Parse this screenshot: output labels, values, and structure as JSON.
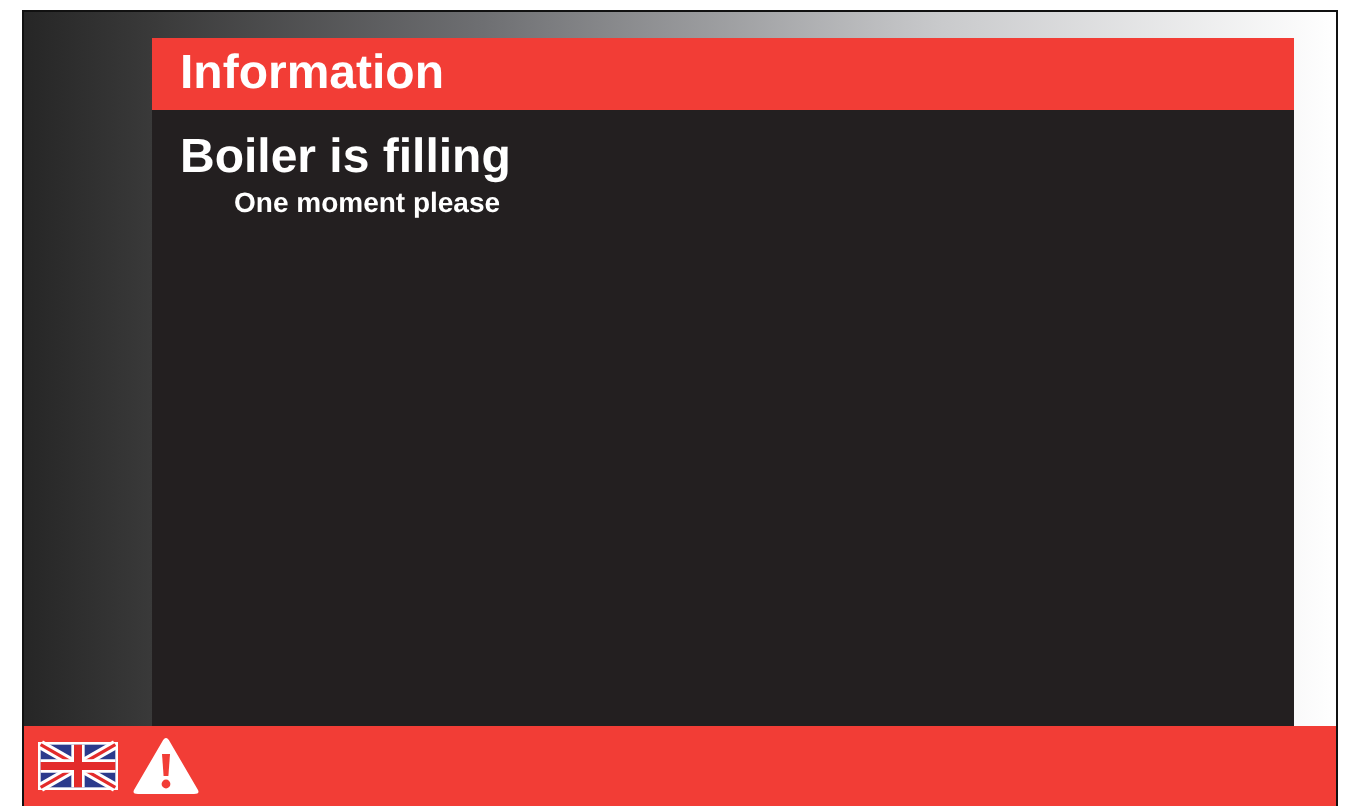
{
  "header": {
    "title": "Information"
  },
  "message": {
    "title": "Boiler is filling",
    "subtitle": "One moment please"
  }
}
